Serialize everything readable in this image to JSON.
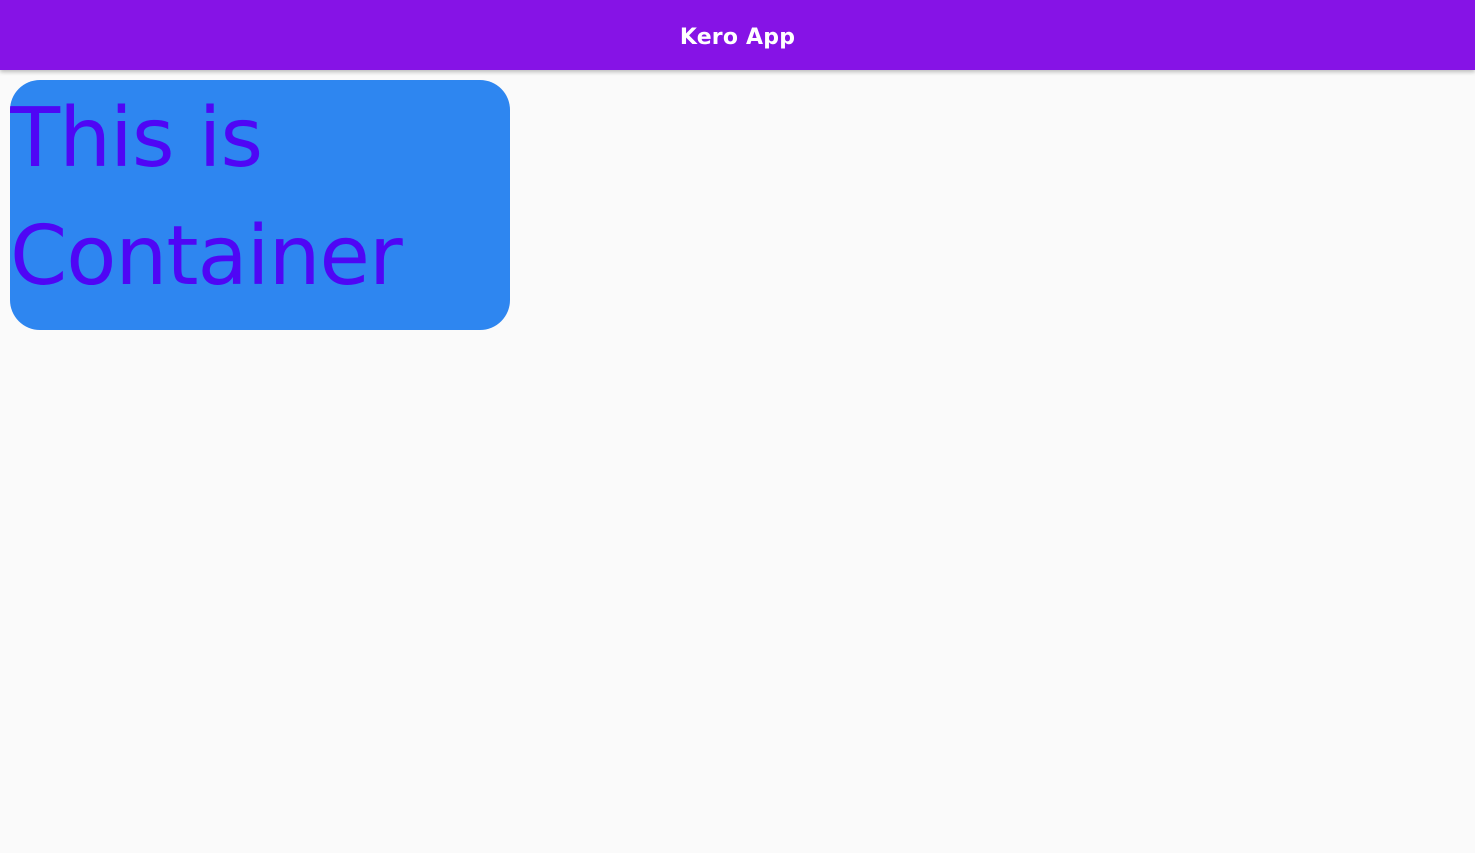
{
  "app_bar": {
    "title": "Kero App",
    "color": "#8613e6"
  },
  "main": {
    "background": "#fafafa",
    "container": {
      "text": "This is Container",
      "background_color": "#2e86f0",
      "text_color": "#4f06f5"
    }
  }
}
